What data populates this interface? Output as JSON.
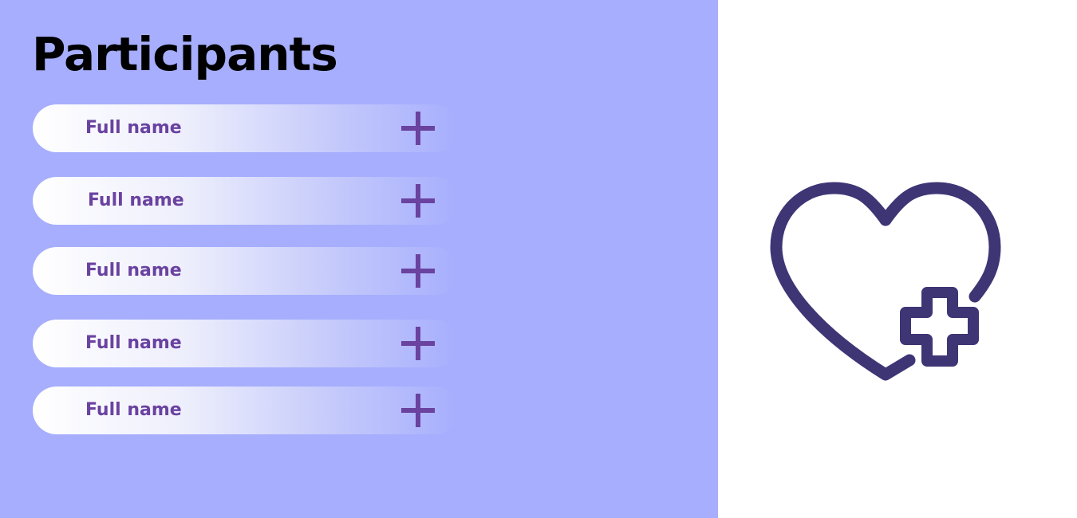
{
  "title": "Participants",
  "participants": [
    {
      "label": "Full name",
      "add_icon": "plus-icon"
    },
    {
      "label": "Full name",
      "add_icon": "plus-icon"
    },
    {
      "label": "Full name",
      "add_icon": "plus-icon"
    },
    {
      "label": "Full name",
      "add_icon": "plus-icon"
    },
    {
      "label": "Full name",
      "add_icon": "plus-icon"
    }
  ],
  "logo": {
    "icon": "heart-plus-icon"
  },
  "colors": {
    "panel_background": "#a6aefd",
    "label_text": "#6a42a0",
    "plus_icon": "#6a42a0",
    "logo_stroke": "#3e3575",
    "title_text": "#000000"
  }
}
